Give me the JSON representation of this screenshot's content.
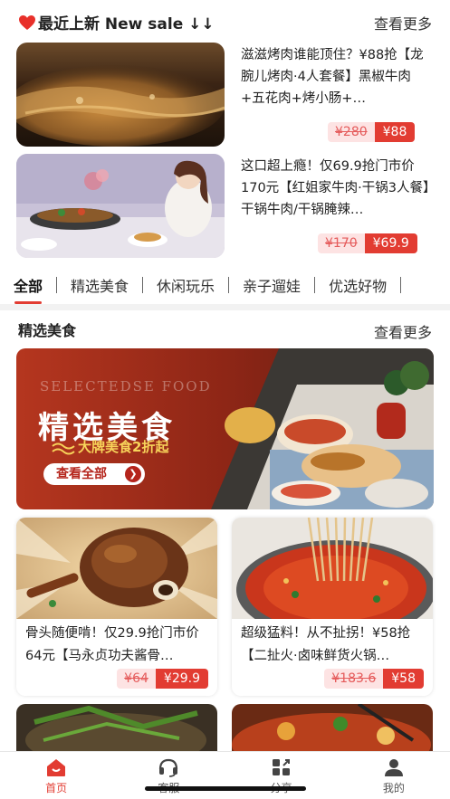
{
  "new_sale": {
    "title": "最近上新 New sale ↓↓",
    "more": "查看更多"
  },
  "new_items": [
    {
      "desc": "滋滋烤肉谁能顶住？¥88抢【龙腕儿烤肉·4人套餐】黑椒牛肉+五花肉+烤小肠+…",
      "orig": "¥280",
      "now": "¥88"
    },
    {
      "desc": "这口超上瘾！仅69.9抢门市价170元【红姐家牛肉·干锅3人餐】干锅牛肉/干锅腌辣…",
      "orig": "¥170",
      "now": "¥69.9"
    }
  ],
  "tabs": [
    "全部",
    "精选美食",
    "休闲玩乐",
    "亲子遛娃",
    "优选好物"
  ],
  "food_section": {
    "title": "精选美食",
    "more": "查看更多"
  },
  "banner": {
    "eng": "SELECTEDSE FOOD",
    "title": "精选美食",
    "sub": "大牌美食2折起",
    "cta": "查看全部"
  },
  "cards": [
    {
      "desc": "骨头随便啃！仅29.9抢门市价64元【马永贞功夫酱骨…",
      "orig": "¥64",
      "now": "¥29.9"
    },
    {
      "desc": "超级猛料！从不扯拐！¥58抢【二扯火·卤味鲜货火锅…",
      "orig": "¥183.6",
      "now": "¥58"
    }
  ],
  "nav": [
    {
      "label": "首页",
      "icon": "home-icon"
    },
    {
      "label": "客服",
      "icon": "headset-icon"
    },
    {
      "label": "分享",
      "icon": "share-icon"
    },
    {
      "label": "我的",
      "icon": "profile-icon"
    }
  ],
  "colors": {
    "accent": "#e23c32",
    "price_bg_light": "#fde3e3"
  }
}
